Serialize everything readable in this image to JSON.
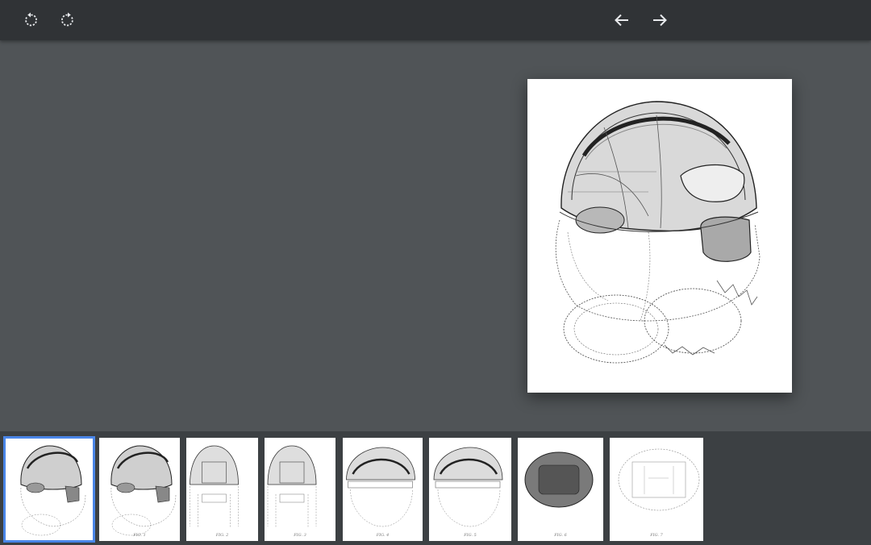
{
  "toolbar": {
    "rotate_left_icon": "rotate-counterclockwise-icon",
    "rotate_right_icon": "rotate-clockwise-icon",
    "prev_icon": "arrow-left-icon",
    "next_icon": "arrow-right-icon"
  },
  "viewer": {
    "current_page_subject": "helmet-drawing"
  },
  "thumbnails": [
    {
      "caption": "",
      "kind": "helmet-iso",
      "selected": true
    },
    {
      "caption": "FIG. 1",
      "kind": "helmet-iso",
      "selected": false
    },
    {
      "caption": "FIG. 2",
      "kind": "helmet-front",
      "selected": false
    },
    {
      "caption": "FIG. 3",
      "kind": "helmet-front",
      "selected": false
    },
    {
      "caption": "FIG. 4",
      "kind": "helmet-side",
      "selected": false
    },
    {
      "caption": "FIG. 5",
      "kind": "helmet-side",
      "selected": false
    },
    {
      "caption": "FIG. 6",
      "kind": "helmet-top",
      "selected": false
    },
    {
      "caption": "FIG. 7",
      "kind": "helmet-bottom",
      "selected": false
    }
  ],
  "colors": {
    "toolbar_bg": "#303336",
    "stage_bg": "#505457",
    "strip_bg": "#3c4043",
    "selection": "#4a86e8"
  }
}
